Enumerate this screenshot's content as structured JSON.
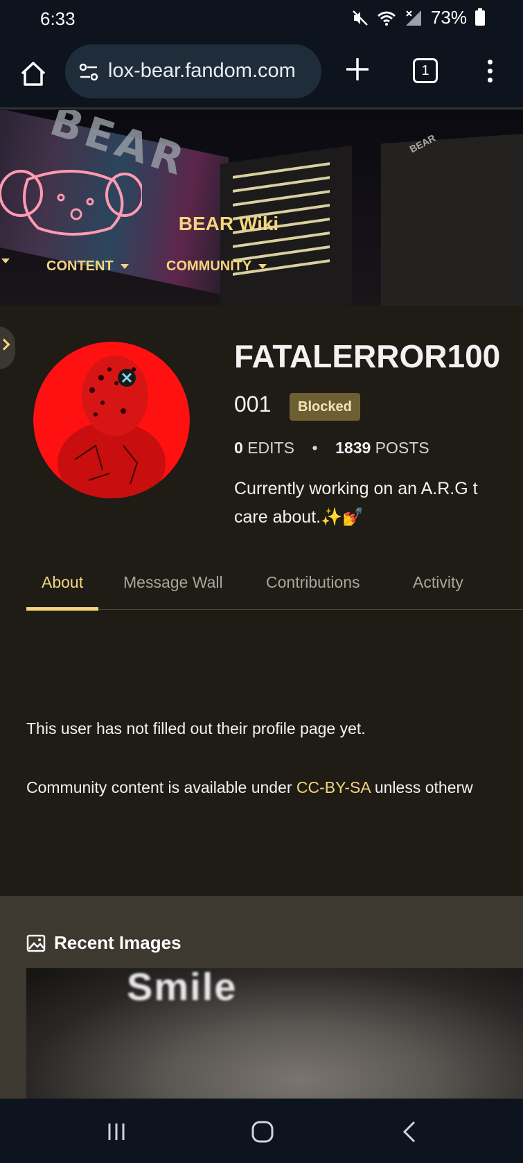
{
  "status_bar": {
    "time": "6:33",
    "battery": "73%"
  },
  "browser": {
    "url": "lox-bear.fandom.com",
    "tab_count": "1"
  },
  "wiki": {
    "title": "BEAR Wiki",
    "nav": [
      {
        "label": ""
      },
      {
        "label": "CONTENT"
      },
      {
        "label": "COMMUNITY"
      }
    ]
  },
  "profile": {
    "username": "FATALERROR100",
    "username_suffix": "001",
    "badge": "Blocked",
    "edits_count": "0",
    "edits_label": "EDITS",
    "posts_count": "1839",
    "posts_label": "POSTS",
    "separator": "•",
    "bio_line1": "Currently working on an A.R.G t",
    "bio_line2": "care about.✨💅"
  },
  "tabs": [
    {
      "label": "About",
      "active": true
    },
    {
      "label": "Message Wall",
      "active": false
    },
    {
      "label": "Contributions",
      "active": false
    },
    {
      "label": "Activity",
      "active": false
    }
  ],
  "about": {
    "empty_message": "This user has not filled out their profile page yet.",
    "license_prefix": "Community content is available under ",
    "license_link": "CC-BY-SA",
    "license_suffix": " unless otherw"
  },
  "recent_images": {
    "title": "Recent Images",
    "thumb_caption": "Smile"
  },
  "colors": {
    "accent": "#f5d57e",
    "page_bg": "#1f1c16",
    "badge_bg": "#6e5f33",
    "browser_bg": "#0d141d"
  }
}
